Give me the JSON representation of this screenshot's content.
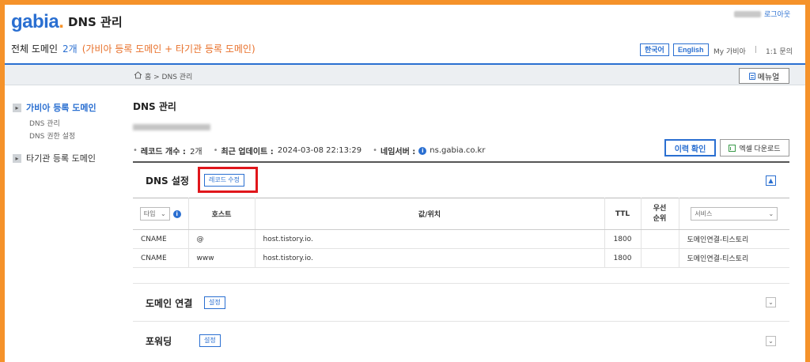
{
  "header": {
    "logo": "gabia",
    "logo_dot": ".",
    "title": "DNS 관리",
    "logout": "로그아웃",
    "all_domain_label": "전체 도메인",
    "all_domain_count": "2개",
    "all_domain_note": "(가비아 등록 도메인 + 타기관 등록 도메인)",
    "lang_ko": "한국어",
    "lang_en": "English",
    "my_gabia": "My 가비아",
    "separator": "|",
    "qna": "1:1 문의"
  },
  "breadcrumb": {
    "text": "홈 > DNS 관리",
    "menu_button": "메뉴얼"
  },
  "sidebar": {
    "items": [
      {
        "label": "가비아 등록 도메인",
        "subitems": [
          "DNS 관리",
          "DNS 권한 설정"
        ]
      },
      {
        "label": "타기관 등록 도메인"
      }
    ]
  },
  "main": {
    "title": "DNS 관리",
    "record_count_label": "레코드 개수 :",
    "record_count_value": "2개",
    "last_update_label": "최근 업데이트 :",
    "last_update_value": "2024-03-08 22:13:29",
    "nameserver_label": "네임서버 :",
    "nameserver_value": "ns.gabia.co.kr",
    "history_button": "이력 확인",
    "excel_button": "엑셀 다운로드"
  },
  "dns_settings": {
    "title": "DNS 설정",
    "record_edit_button": "레코드 수정",
    "columns": {
      "type": "타입",
      "host": "호스트",
      "value": "값/위치",
      "ttl": "TTL",
      "priority": "우선 순위",
      "service": "서비스"
    },
    "rows": [
      {
        "type": "CNAME",
        "host": "@",
        "value": "host.tistory.io.",
        "ttl": "1800",
        "priority": "",
        "service": "도메인연결-티스토리"
      },
      {
        "type": "CNAME",
        "host": "www",
        "value": "host.tistory.io.",
        "ttl": "1800",
        "priority": "",
        "service": "도메인연결-티스토리"
      }
    ]
  },
  "domain_link": {
    "title": "도메인 연결",
    "button": "설정"
  },
  "forwarding": {
    "title": "포워딩",
    "button": "설정"
  },
  "colors": {
    "accent": "#2a6fd1",
    "frame": "#f5922a",
    "highlight": "#e0161b",
    "note": "#e8702a"
  }
}
